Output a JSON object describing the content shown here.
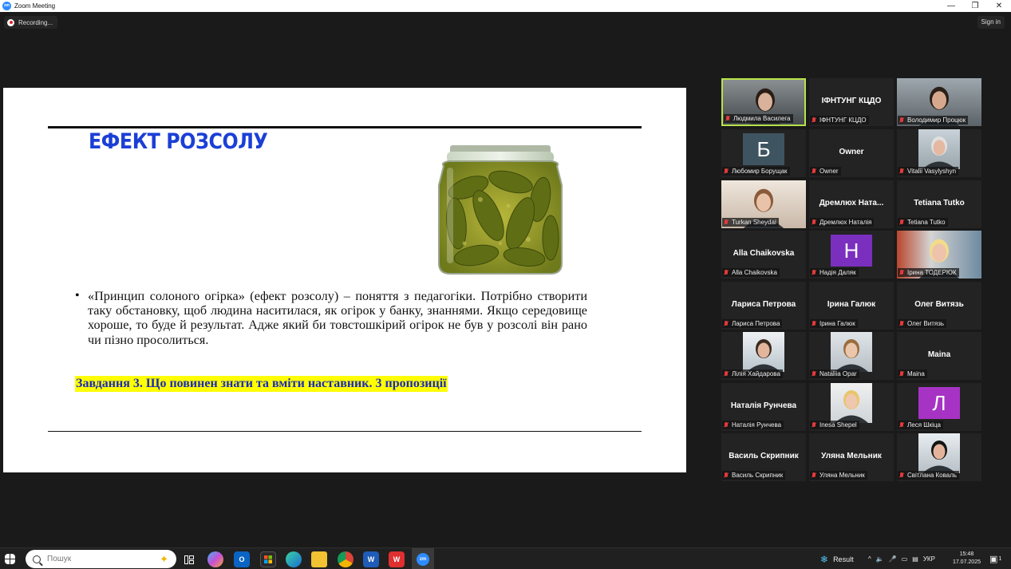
{
  "window": {
    "title": "Zoom Meeting",
    "controls": {
      "minimize": "—",
      "restore": "❐",
      "close": "✕"
    }
  },
  "recording": {
    "label": "Recording..."
  },
  "header": {
    "sign_in": "Sign in"
  },
  "slide": {
    "title": "ЕФЕКТ РОЗСОЛУ",
    "bullet": "«Принцип солоного огірка» (ефект розсолу) – поняття з педагогіки. Потрібно створити таку обстановку, щоб людина наситилася, як огірок у банку, знаннями. Якщо середовище хороше, то буде й результат. Адже який би товстошкірий огірок не був у розсолі він рано чи пізно просолиться.",
    "task": "Завдання 3. Що повинен знати та вміти наставник. 3 пропозиції"
  },
  "participants": [
    {
      "name": "Людмила Василега",
      "display": "",
      "kind": "video"
    },
    {
      "name": "ІФНТУНГ КЦДО",
      "display": "ІФНТУНГ КЦДО",
      "kind": "name"
    },
    {
      "name": "Володимир Процюк",
      "display": "",
      "kind": "video"
    },
    {
      "name": "Любомир Борущак",
      "display": "Б",
      "kind": "letter",
      "color": "#3f5461"
    },
    {
      "name": "Owner",
      "display": "Owner",
      "kind": "name"
    },
    {
      "name": "Vitalii Vasylyshyn",
      "display": "",
      "kind": "photo"
    },
    {
      "name": "Turkan Sheydai",
      "display": "",
      "kind": "video"
    },
    {
      "name": "Дремлюх Наталія",
      "display": "Дремлюх Ната...",
      "kind": "name"
    },
    {
      "name": "Tetiana Tutko",
      "display": "Tetiana Tutko",
      "kind": "name"
    },
    {
      "name": "Alla Chaikovska",
      "display": "Alla Chaikovska",
      "kind": "name"
    },
    {
      "name": "Надія Даляк",
      "display": "Н",
      "kind": "letter",
      "color": "#7b2fbf"
    },
    {
      "name": "Ірина ТОДЕРЮК",
      "display": "",
      "kind": "video"
    },
    {
      "name": "Лариса Петрова",
      "display": "Лариса Петрова",
      "kind": "name"
    },
    {
      "name": "Ірина Галюк",
      "display": "Ірина Галюк",
      "kind": "name"
    },
    {
      "name": "Олег Витязь",
      "display": "Олег Витязь",
      "kind": "name"
    },
    {
      "name": "Лілія Хайдарова",
      "display": "",
      "kind": "photo"
    },
    {
      "name": "Nataliia Opar",
      "display": "",
      "kind": "photo"
    },
    {
      "name": "Maina",
      "display": "Maina",
      "kind": "name"
    },
    {
      "name": "Наталія Рунчева",
      "display": "Наталія Рунчева",
      "kind": "name"
    },
    {
      "name": "Inesa Shepel",
      "display": "",
      "kind": "photo"
    },
    {
      "name": "Леся Шкіца",
      "display": "Л",
      "kind": "letter",
      "color": "#a733c4"
    },
    {
      "name": "Василь Скрипник",
      "display": "Василь Скрипник",
      "kind": "name"
    },
    {
      "name": "Уляна Мельник",
      "display": "Уляна Мельник",
      "kind": "name"
    },
    {
      "name": "Світлана Коваль",
      "display": "",
      "kind": "photo"
    }
  ],
  "taskbar": {
    "search_placeholder": "Пошук",
    "weather_label": "Result",
    "language": "УКР",
    "time": "15:48",
    "date": "17.07.2025",
    "notification_count": "1"
  }
}
